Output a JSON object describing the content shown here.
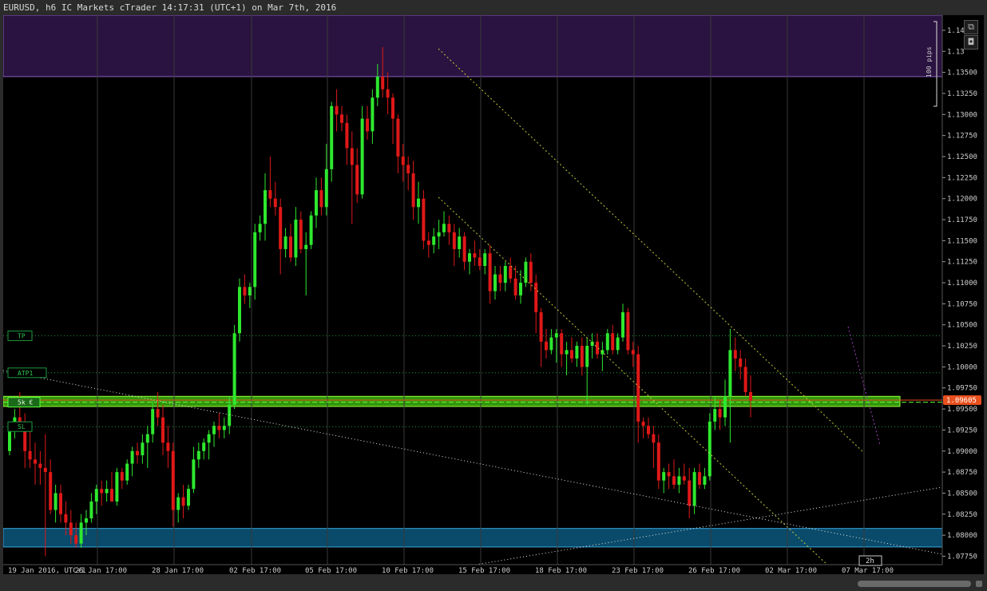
{
  "window": {
    "title": "EURUSD, h6 IC Markets cTrader 14:17:31 (UTC+1) on Mar 7th, 2016"
  },
  "toolbar": {
    "detach_icon": "external-link-icon",
    "screenshot_icon": "camera-icon"
  },
  "colors": {
    "background": "#000000",
    "bull": "#2ee82e",
    "bear": "#e01818",
    "grid": "#2a2a2a",
    "axis_text": "#cfcfcf",
    "current_price": "#e8501e",
    "supply_zone": "#2a1340",
    "demand_zone": "#0a4a6a",
    "order_zone": "#3cb00e",
    "trendline": "#d8d86a"
  },
  "price_axis": {
    "labels": [
      "1.14",
      "1.13",
      "1.13500",
      "1.13250",
      "1.13000",
      "1.12750",
      "1.12500",
      "1.12250",
      "1.12000",
      "1.11750",
      "1.11500",
      "1.11250",
      "1.11000",
      "1.10750",
      "1.10500",
      "1.10250",
      "1.10000",
      "1.09750",
      "1.09500",
      "1.09250",
      "1.09000",
      "1.08750",
      "1.08500",
      "1.08250",
      "1.08000",
      "1.07750"
    ],
    "current_price_label": "1.09605",
    "pips_label": "100 pips"
  },
  "time_axis": {
    "labels": [
      "19 Jan 2016, UTC+1",
      "25 Jan 17:00",
      "28 Jan 17:00",
      "02 Feb 17:00",
      "05 Feb 17:00",
      "10 Feb 17:00",
      "15 Feb 17:00",
      "18 Feb 17:00",
      "23 Feb 17:00",
      "26 Feb 17:00",
      "02 Mar 17:00",
      "07 Mar 17:00"
    ],
    "timer_label": "2h"
  },
  "order_lines": {
    "tp_label": "TP",
    "atp_label": "ATP1",
    "position_label": "5k €",
    "sl_label": "SL"
  },
  "chart_data": {
    "type": "candlestick",
    "symbol": "EURUSD",
    "timeframe": "h6",
    "ylim": [
      1.0765,
      1.1418
    ],
    "current_price": 1.09605,
    "x": [
      "19 Jan 2016",
      "25 Jan 17:00",
      "28 Jan 17:00",
      "02 Feb 17:00",
      "05 Feb 17:00",
      "10 Feb 17:00",
      "15 Feb 17:00",
      "18 Feb 17:00",
      "23 Feb 17:00",
      "26 Feb 17:00",
      "02 Mar 17:00",
      "07 Mar 17:00"
    ],
    "candles": [
      [
        1.09,
        1.093,
        1.0895,
        1.0925
      ],
      [
        1.0925,
        1.095,
        1.0915,
        1.094
      ],
      [
        1.094,
        1.097,
        1.0925,
        1.093
      ],
      [
        1.093,
        1.0945,
        1.088,
        1.09
      ],
      [
        1.09,
        1.0935,
        1.088,
        1.089
      ],
      [
        1.089,
        1.091,
        1.086,
        1.0885
      ],
      [
        1.0885,
        1.09,
        1.086,
        1.088
      ],
      [
        1.088,
        1.092,
        1.0775,
        1.0875
      ],
      [
        1.0875,
        1.089,
        1.0825,
        1.083
      ],
      [
        1.083,
        1.086,
        1.0815,
        1.085
      ],
      [
        1.085,
        1.086,
        1.0815,
        1.0825
      ],
      [
        1.0825,
        1.084,
        1.08,
        1.0815
      ],
      [
        1.0815,
        1.083,
        1.079,
        1.08
      ],
      [
        1.08,
        1.0815,
        1.0785,
        1.079
      ],
      [
        1.079,
        1.0825,
        1.0785,
        1.0815
      ],
      [
        1.0815,
        1.083,
        1.08,
        1.082
      ],
      [
        1.082,
        1.085,
        1.0815,
        1.084
      ],
      [
        1.084,
        1.086,
        1.0825,
        1.0855
      ],
      [
        1.0855,
        1.0865,
        1.0835,
        1.085
      ],
      [
        1.085,
        1.0865,
        1.084,
        1.0855
      ],
      [
        1.0855,
        1.0875,
        1.0845,
        1.084
      ],
      [
        1.084,
        1.088,
        1.0835,
        1.0875
      ],
      [
        1.0875,
        1.088,
        1.0855,
        1.0865
      ],
      [
        1.0865,
        1.089,
        1.086,
        1.0885
      ],
      [
        1.0885,
        1.0905,
        1.087,
        1.09
      ],
      [
        1.09,
        1.091,
        1.0885,
        1.0895
      ],
      [
        1.0895,
        1.092,
        1.0885,
        1.091
      ],
      [
        1.091,
        1.093,
        1.088,
        1.092
      ],
      [
        1.092,
        1.096,
        1.091,
        1.095
      ],
      [
        1.095,
        1.097,
        1.093,
        1.094
      ],
      [
        1.094,
        1.0955,
        1.0895,
        1.091
      ],
      [
        1.091,
        1.093,
        1.088,
        1.09
      ],
      [
        1.09,
        1.091,
        1.081,
        1.083
      ],
      [
        1.083,
        1.085,
        1.0815,
        1.0845
      ],
      [
        1.0845,
        1.086,
        1.082,
        1.0835
      ],
      [
        1.0835,
        1.086,
        1.083,
        1.0855
      ],
      [
        1.0855,
        1.0905,
        1.085,
        1.089
      ],
      [
        1.089,
        1.091,
        1.088,
        1.09
      ],
      [
        1.09,
        1.0915,
        1.089,
        1.091
      ],
      [
        1.091,
        1.0925,
        1.089,
        1.092
      ],
      [
        1.092,
        1.0935,
        1.0905,
        1.093
      ],
      [
        1.093,
        1.0945,
        1.0915,
        1.0925
      ],
      [
        1.0925,
        1.094,
        1.0915,
        1.093
      ],
      [
        1.093,
        1.0965,
        1.092,
        1.0955
      ],
      [
        1.0955,
        1.105,
        1.095,
        1.104
      ],
      [
        1.104,
        1.1105,
        1.103,
        1.1095
      ],
      [
        1.1095,
        1.111,
        1.1075,
        1.1085
      ],
      [
        1.1085,
        1.11,
        1.107,
        1.1095
      ],
      [
        1.1095,
        1.117,
        1.108,
        1.116
      ],
      [
        1.116,
        1.118,
        1.115,
        1.117
      ],
      [
        1.117,
        1.123,
        1.115,
        1.121
      ],
      [
        1.121,
        1.125,
        1.119,
        1.12
      ],
      [
        1.12,
        1.122,
        1.118,
        1.119
      ],
      [
        1.119,
        1.12,
        1.111,
        1.114
      ],
      [
        1.114,
        1.1165,
        1.113,
        1.1155
      ],
      [
        1.1155,
        1.117,
        1.1125,
        1.113
      ],
      [
        1.113,
        1.119,
        1.112,
        1.1175
      ],
      [
        1.1175,
        1.1185,
        1.1135,
        1.114
      ],
      [
        1.114,
        1.116,
        1.1085,
        1.1145
      ],
      [
        1.1145,
        1.1185,
        1.114,
        1.118
      ],
      [
        1.118,
        1.1225,
        1.1165,
        1.121
      ],
      [
        1.121,
        1.1225,
        1.118,
        1.119
      ],
      [
        1.119,
        1.1265,
        1.118,
        1.1235
      ],
      [
        1.1235,
        1.1315,
        1.122,
        1.131
      ],
      [
        1.131,
        1.133,
        1.128,
        1.13
      ],
      [
        1.13,
        1.131,
        1.128,
        1.129
      ],
      [
        1.129,
        1.13,
        1.124,
        1.126
      ],
      [
        1.126,
        1.128,
        1.117,
        1.124
      ],
      [
        1.124,
        1.126,
        1.1195,
        1.1205
      ],
      [
        1.1205,
        1.131,
        1.12,
        1.1295
      ],
      [
        1.1295,
        1.131,
        1.127,
        1.128
      ],
      [
        1.128,
        1.133,
        1.1265,
        1.132
      ],
      [
        1.132,
        1.136,
        1.131,
        1.1345
      ],
      [
        1.1345,
        1.138,
        1.132,
        1.133
      ],
      [
        1.133,
        1.135,
        1.13,
        1.132
      ],
      [
        1.132,
        1.1325,
        1.1265,
        1.1295
      ],
      [
        1.1295,
        1.13,
        1.123,
        1.125
      ],
      [
        1.125,
        1.1265,
        1.122,
        1.124
      ],
      [
        1.124,
        1.125,
        1.121,
        1.123
      ],
      [
        1.123,
        1.1245,
        1.1175,
        1.119
      ],
      [
        1.119,
        1.122,
        1.117,
        1.12
      ],
      [
        1.12,
        1.121,
        1.114,
        1.115
      ],
      [
        1.115,
        1.116,
        1.113,
        1.1145
      ],
      [
        1.1145,
        1.1165,
        1.1135,
        1.1155
      ],
      [
        1.1155,
        1.1175,
        1.114,
        1.116
      ],
      [
        1.116,
        1.1185,
        1.1155,
        1.117
      ],
      [
        1.117,
        1.118,
        1.1145,
        1.116
      ],
      [
        1.116,
        1.117,
        1.112,
        1.114
      ],
      [
        1.114,
        1.1165,
        1.113,
        1.1155
      ],
      [
        1.1155,
        1.116,
        1.1115,
        1.1125
      ],
      [
        1.1125,
        1.114,
        1.111,
        1.1135
      ],
      [
        1.1135,
        1.115,
        1.112,
        1.113
      ],
      [
        1.113,
        1.114,
        1.1115,
        1.112
      ],
      [
        1.112,
        1.114,
        1.111,
        1.1135
      ],
      [
        1.1135,
        1.1145,
        1.1075,
        1.109
      ],
      [
        1.109,
        1.112,
        1.108,
        1.111
      ],
      [
        1.111,
        1.112,
        1.109,
        1.11
      ],
      [
        1.11,
        1.1125,
        1.109,
        1.112
      ],
      [
        1.112,
        1.113,
        1.11,
        1.1105
      ],
      [
        1.1105,
        1.112,
        1.108,
        1.1085
      ],
      [
        1.1085,
        1.1115,
        1.1075,
        1.11
      ],
      [
        1.11,
        1.113,
        1.1095,
        1.1125
      ],
      [
        1.1125,
        1.1135,
        1.109,
        1.11
      ],
      [
        1.11,
        1.111,
        1.104,
        1.1065
      ],
      [
        1.1065,
        1.107,
        1.1,
        1.103
      ],
      [
        1.103,
        1.1045,
        1.101,
        1.102
      ],
      [
        1.102,
        1.1045,
        1.1015,
        1.1035
      ],
      [
        1.1035,
        1.1045,
        1.1005,
        1.104
      ],
      [
        1.104,
        1.1045,
        1.1,
        1.1015
      ],
      [
        1.1015,
        1.103,
        1.099,
        1.102
      ],
      [
        1.102,
        1.1035,
        1.1005,
        1.101
      ],
      [
        1.101,
        1.103,
        1.1,
        1.1025
      ],
      [
        1.1025,
        1.1035,
        1.099,
        1.1
      ],
      [
        1.1,
        1.1035,
        1.0955,
        1.1025
      ],
      [
        1.1025,
        1.104,
        1.101,
        1.103
      ],
      [
        1.103,
        1.104,
        1.101,
        1.1015
      ],
      [
        1.1015,
        1.103,
        1.0995,
        1.102
      ],
      [
        1.102,
        1.1045,
        1.1015,
        1.104
      ],
      [
        1.104,
        1.105,
        1.1015,
        1.102
      ],
      [
        1.102,
        1.104,
        1.1015,
        1.1035
      ],
      [
        1.1035,
        1.1075,
        1.103,
        1.1065
      ],
      [
        1.1065,
        1.107,
        1.1015,
        1.102
      ],
      [
        1.102,
        1.103,
        1.1,
        1.1015
      ],
      [
        1.1015,
        1.1025,
        1.091,
        1.0935
      ],
      [
        1.0935,
        1.094,
        1.0915,
        1.093
      ],
      [
        1.093,
        1.094,
        1.0915,
        1.092
      ],
      [
        1.092,
        1.093,
        1.088,
        1.091
      ],
      [
        1.091,
        1.092,
        1.0855,
        1.0865
      ],
      [
        1.0865,
        1.088,
        1.085,
        1.0875
      ],
      [
        1.0875,
        1.0885,
        1.0855,
        1.087
      ],
      [
        1.087,
        1.089,
        1.0855,
        1.086
      ],
      [
        1.086,
        1.088,
        1.085,
        1.087
      ],
      [
        1.087,
        1.0885,
        1.086,
        1.0865
      ],
      [
        1.0865,
        1.088,
        1.082,
        1.0835
      ],
      [
        1.0835,
        1.088,
        1.0825,
        1.0875
      ],
      [
        1.0875,
        1.0885,
        1.0855,
        1.086
      ],
      [
        1.086,
        1.088,
        1.0855,
        1.087
      ],
      [
        1.087,
        1.0945,
        1.0865,
        1.0935
      ],
      [
        1.0935,
        1.0965,
        1.0925,
        1.095
      ],
      [
        1.095,
        1.096,
        1.0925,
        1.094
      ],
      [
        1.094,
        1.0985,
        1.093,
        1.0965
      ],
      [
        1.0965,
        1.1045,
        1.091,
        1.102
      ],
      [
        1.102,
        1.1035,
        1.0995,
        1.101
      ],
      [
        1.101,
        1.102,
        1.0985,
        1.1
      ],
      [
        1.1,
        1.101,
        1.0965,
        1.097
      ],
      [
        1.097,
        1.099,
        1.094,
        1.096
      ]
    ],
    "horizontal_levels": {
      "TP": 1.1037,
      "ATP1": 1.0993,
      "position": 1.0958,
      "SL": 1.0929
    },
    "zones": [
      {
        "name": "supply",
        "from": 1.1345,
        "to": 1.1418
      },
      {
        "name": "demand",
        "from": 1.0786,
        "to": 1.0808
      },
      {
        "name": "order",
        "from": 1.0953,
        "to": 1.0965
      }
    ]
  }
}
